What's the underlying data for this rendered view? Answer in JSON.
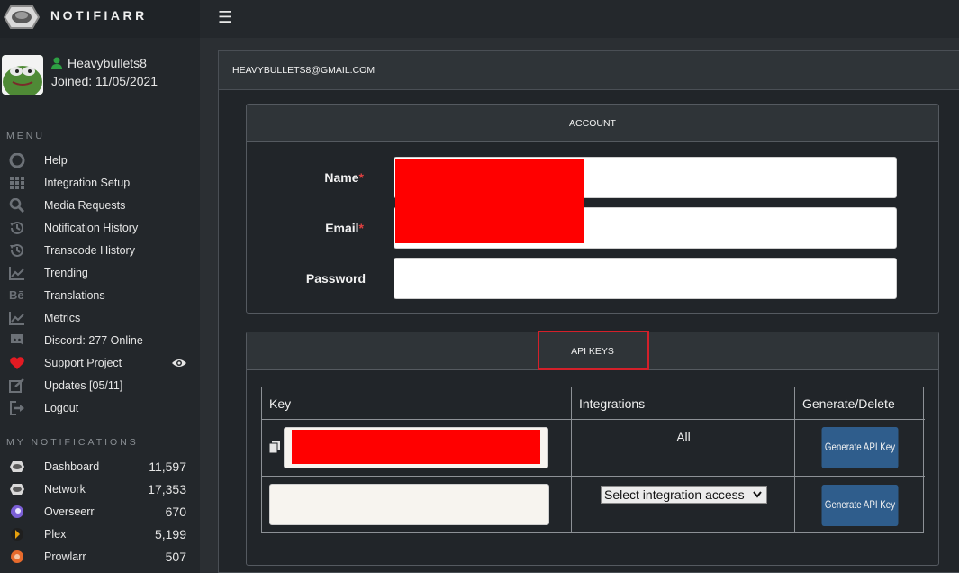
{
  "brand": {
    "name": "NOTIFIARR"
  },
  "user": {
    "name": "Heavybullets8",
    "joined": "Joined: 11/05/2021"
  },
  "sidebar": {
    "menu_label": "MENU",
    "menu": [
      {
        "label": "Help",
        "icon": "lifebuoy-icon"
      },
      {
        "label": "Integration Setup",
        "icon": "grid-icon"
      },
      {
        "label": "Media Requests",
        "icon": "search-icon"
      },
      {
        "label": "Notification History",
        "icon": "history-icon"
      },
      {
        "label": "Transcode History",
        "icon": "history-icon"
      },
      {
        "label": "Trending",
        "icon": "trending-icon"
      },
      {
        "label": "Translations",
        "icon": "behance-icon"
      },
      {
        "label": "Metrics",
        "icon": "chart-icon"
      },
      {
        "label": "Discord: 277 Online",
        "icon": "discord-icon"
      },
      {
        "label": "Support Project",
        "icon": "heart-icon"
      },
      {
        "label": "Updates [05/11]",
        "icon": "edit-icon"
      },
      {
        "label": "Logout",
        "icon": "logout-icon"
      }
    ],
    "notifications_label": "MY NOTIFICATIONS",
    "notifications": [
      {
        "label": "Dashboard",
        "count": "11,597",
        "icon": "notifiarr-icon"
      },
      {
        "label": "Network",
        "count": "17,353",
        "icon": "notifiarr-icon"
      },
      {
        "label": "Overseerr",
        "count": "670",
        "icon": "overseerr-icon"
      },
      {
        "label": "Plex",
        "count": "5,199",
        "icon": "plex-icon"
      },
      {
        "label": "Prowlarr",
        "count": "507",
        "icon": "prowlarr-icon"
      }
    ]
  },
  "main": {
    "header": "HEAVYBULLETS8@GMAIL.COM",
    "account": {
      "title": "ACCOUNT",
      "name_label": "Name",
      "email_label": "Email",
      "password_label": "Password",
      "required_mark": "*"
    },
    "api": {
      "title": "API KEYS",
      "columns": [
        "Key",
        "Integrations",
        "Generate/Delete"
      ],
      "rows": [
        {
          "integrations": "All",
          "button": "Generate API Key"
        },
        {
          "select": "Select integration access",
          "button": "Generate API Key"
        }
      ]
    }
  },
  "colors": {
    "accent": "#2f5d8c",
    "redaction": "#ff0000",
    "required": "#e04040",
    "highlight": "#d4202a"
  }
}
